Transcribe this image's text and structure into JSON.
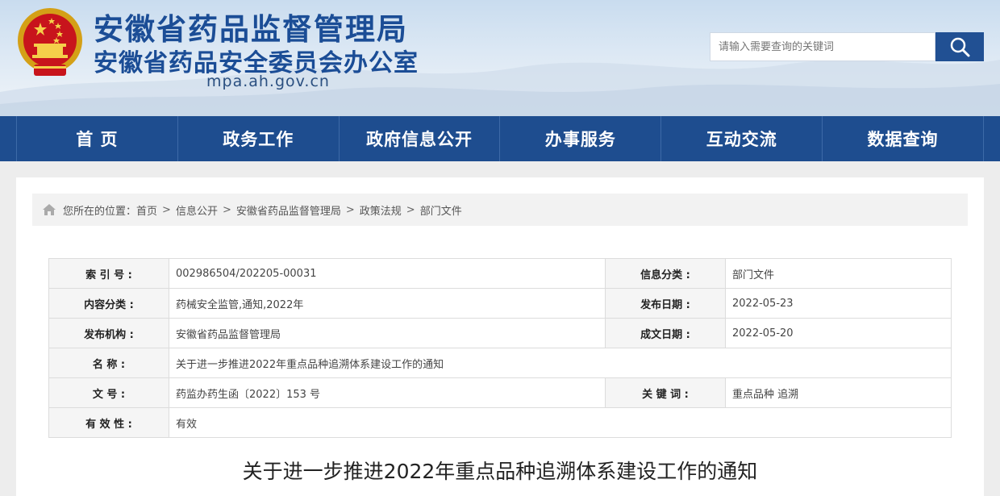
{
  "header": {
    "site_name_line1": "安徽省药品监督管理局",
    "site_name_line2": "安徽省药品安全委员会办公室",
    "domain": "mpa.ah.gov.cn",
    "search_placeholder": "请输入需要查询的关键词",
    "brand_color": "#1b4d96"
  },
  "nav": {
    "items": [
      {
        "label": "首 页"
      },
      {
        "label": "政务工作"
      },
      {
        "label": "政府信息公开"
      },
      {
        "label": "办事服务"
      },
      {
        "label": "互动交流"
      },
      {
        "label": "数据查询"
      }
    ],
    "bg_color": "#1e4d8f"
  },
  "breadcrumb": {
    "prefix": "您所在的位置：",
    "items": [
      "首页",
      "信息公开",
      "安徽省药品监督管理局",
      "政策法规",
      "部门文件"
    ],
    "separator": ">"
  },
  "meta": {
    "index_label": "索 引 号 :",
    "index_value": "002986504/202205-00031",
    "category_label": "信息分类 :",
    "category_value": "部门文件",
    "content_label": "内容分类 :",
    "content_value": "药械安全监管,通知,2022年",
    "publish_date_label": "发布日期 :",
    "publish_date_value": "2022-05-23",
    "org_label": "发布机构 :",
    "org_value": "安徽省药品监督管理局",
    "created_date_label": "成文日期 :",
    "created_date_value": "2022-05-20",
    "name_label": "名 称 :",
    "name_value": "关于进一步推进2022年重点品种追溯体系建设工作的通知",
    "docno_label": "文 号 :",
    "docno_value": "药监办药生函〔2022〕153 号",
    "keywords_label": "关 键 词 :",
    "keywords_value": "重点品种 追溯",
    "validity_label": "有 效 性 :",
    "validity_value": "有效"
  },
  "document": {
    "title": "关于进一步推进2022年重点品种追溯体系建设工作的通知"
  }
}
